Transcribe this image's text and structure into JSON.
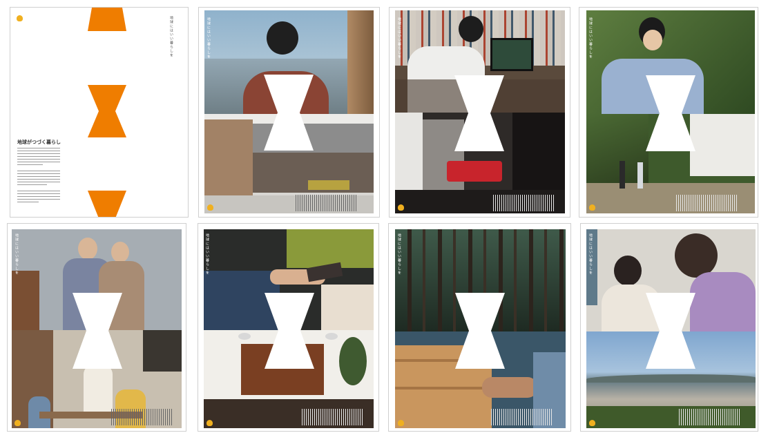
{
  "cover": {
    "brand_text": "",
    "tagline": "地球にはいい暮らしを",
    "heading": "地球がつづく暮らし",
    "accent_color": "#ef7d00"
  },
  "spread_tagline": "地球にはいい暮らしを",
  "cutout_shape": "hourglass",
  "spreads": [
    {
      "id": "woman-window"
    },
    {
      "id": "man-desk"
    },
    {
      "id": "man-garden"
    },
    {
      "id": "couple-family"
    },
    {
      "id": "hands-samples"
    },
    {
      "id": "forest-wood"
    },
    {
      "id": "mother-daughter-city"
    }
  ]
}
